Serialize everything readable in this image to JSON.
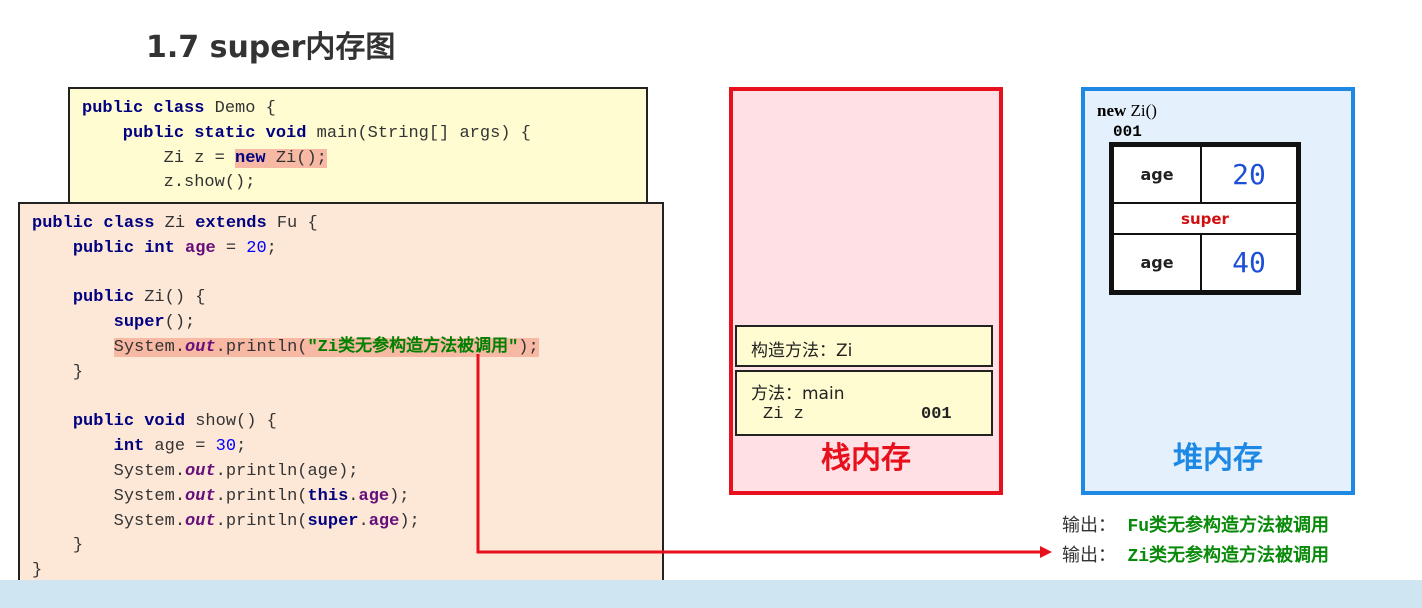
{
  "title": "1.7 super内存图",
  "demo_code": {
    "l1a": "public class",
    "l1b": " Demo {",
    "l2a": "    public static void",
    "l2b": " main(String[] args) {",
    "l3a": "        Zi z = ",
    "l3b": "new",
    "l3c": " Zi();",
    "l4": "        z.show();"
  },
  "zi_code": {
    "kw_pc": "public class",
    "zi": " Zi ",
    "ext": "extends",
    "fu": " Fu {",
    "pi": "public int",
    "age": "age",
    "eq": " = ",
    "n20": "20",
    "semi": ";",
    "pub": "public",
    "ctor": " Zi() {",
    "sup": "super",
    "supcall": "();",
    "sys": "System.",
    "out": "out",
    "println": ".println(",
    "str": "\"Zi类无参构造方法被调用\"",
    "end": ");",
    "close": "}",
    "pv": "public void",
    "show": " show() {",
    "int": "int",
    "age30": " age = ",
    "n30": "30",
    "p_age": "age);",
    "this": "this",
    "dot": ".",
    "sup2": "super"
  },
  "stack": {
    "label": "栈内存",
    "frames": [
      {
        "title": "构造方法：Zi"
      },
      {
        "title": "方法：main",
        "var": "Zi z",
        "value": "001"
      }
    ]
  },
  "heap": {
    "label": "堆内存",
    "new_kw": "new",
    "new_rest": "Zi()",
    "address": "001",
    "rows": [
      {
        "name": "age",
        "value": "20"
      },
      {
        "name": "super"
      },
      {
        "name": "age",
        "value": "40"
      }
    ]
  },
  "output": [
    {
      "prefix": "输出：",
      "text": "Fu类无参构造方法被调用"
    },
    {
      "prefix": "输出：",
      "text": "Zi类无参构造方法被调用"
    }
  ],
  "colors": {
    "stack": "#e8101c",
    "heap": "#1e88e5",
    "output": "#0a8a0a"
  }
}
